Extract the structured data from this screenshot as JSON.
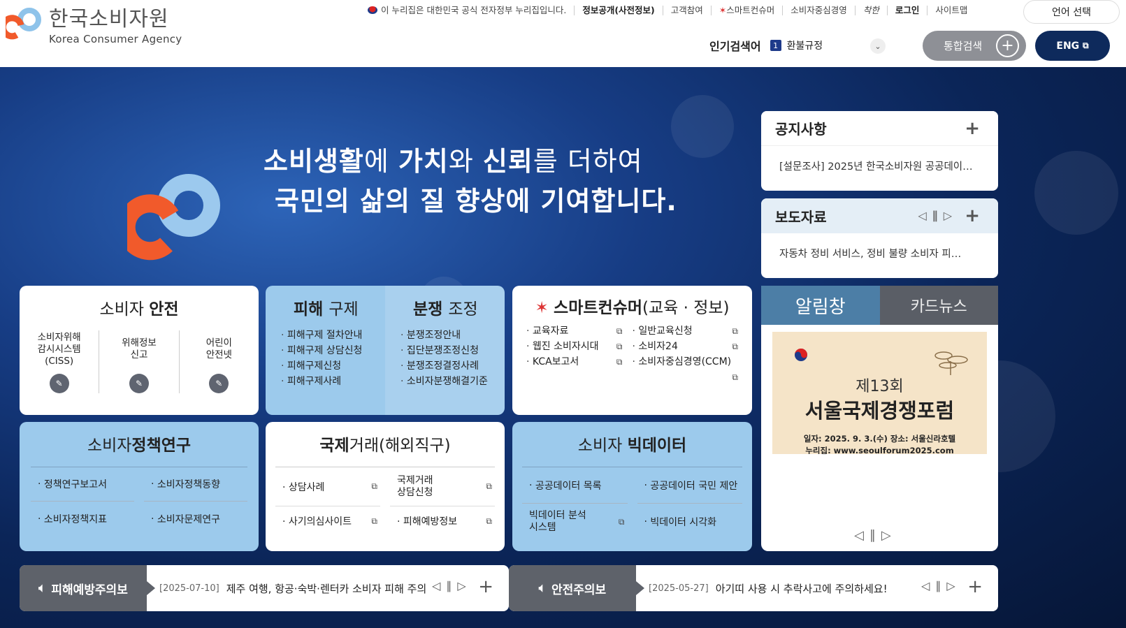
{
  "header": {
    "logo_ko": "한국소비자원",
    "logo_en": "Korea Consumer Agency",
    "gov_notice": "이 누리집은 대한민국 공식 전자정부 누리집입니다.",
    "util_links": [
      "정보공개(사전정보)",
      "고객참여",
      "스마트컨슈머",
      "소비자중심경영",
      "착한",
      "로그인",
      "사이트맵"
    ],
    "language_select": "언어 선택",
    "popular_label": "인기검색어",
    "popular_rank": "1",
    "popular_term": "환불규정",
    "search_label": "통합검색",
    "eng_label": "ENG"
  },
  "hero": {
    "line1_a": "소비생활",
    "line1_b": "에 ",
    "line1_c": "가치",
    "line1_d": "와 ",
    "line1_e": "신뢰",
    "line1_f": "를 더하여",
    "line2": "국민의 삶의 질 향상에 기여합니다."
  },
  "safety": {
    "title_a": "소비자 ",
    "title_b": "안전",
    "items": [
      "소비자위해\n감시시스템\n(CISS)",
      "위해정보\n신고",
      "어린이\n안전넷"
    ]
  },
  "relief": {
    "title_a": "피해 ",
    "title_b": "구제",
    "items": [
      "피해구제 절차안내",
      "피해구제 상담신청",
      "피해구제신청",
      "피해구제사례"
    ]
  },
  "dispute": {
    "title_a": "분쟁 ",
    "title_b": "조정",
    "items": [
      "분쟁조정안내",
      "집단분쟁조정신청",
      "분쟁조정결정사례",
      "소비자분쟁해결기준"
    ]
  },
  "smart": {
    "title_a": "스마트컨슈머",
    "title_b": "(교육 · 정보)",
    "left": [
      "교육자료",
      "웹진 소비자시대",
      "KCA보고서"
    ],
    "right": [
      "일반교육신청",
      "소비자24",
      "소비자중심경영(CCM)"
    ]
  },
  "policy": {
    "title_a": "소비자",
    "title_b": "정책연구",
    "items": [
      "정책연구보고서",
      "소비자정책동향",
      "소비자정책지표",
      "소비자문제연구"
    ]
  },
  "intl": {
    "title_a": "국제",
    "title_b": "거래(해외직구)",
    "items": [
      "상담사례",
      "국제거래\n상담신청",
      "사기의심사이트",
      "피해예방정보"
    ]
  },
  "bigdata": {
    "title_a": "소비자 ",
    "title_b": "빅데이터",
    "items": [
      "공공데이터 목록",
      "공공데이터 국민 제안",
      "빅데이터 분석\n시스템",
      "빅데이터 시각화"
    ]
  },
  "notice": {
    "title": "공지사항",
    "text": "[설문조사] 2025년 한국소비자원 공공데이…"
  },
  "press": {
    "title": "보도자료",
    "text": "자동차 정비 서비스, 정비 불량 소비자 피…"
  },
  "alarm": {
    "tab_on": "알림창",
    "tab_off": "카드뉴스",
    "poster_title": "제13회",
    "poster_sub": "서울국제경쟁포럼",
    "poster_info": "일자: 2025. 9. 3.(수)   장소: 서울신라호텔",
    "poster_url": "누리집: www.seoulforum2025.com"
  },
  "warn1": {
    "label": "피해예방주의보",
    "date": "[2025-07-10]",
    "text": "제주 여행, 항공·숙박·렌터카 소비자 피해 주의"
  },
  "warn2": {
    "label": "안전주의보",
    "date": "[2025-05-27]",
    "text": "아기띠 사용 시 추락사고에 주의하세요!"
  },
  "colors": {
    "brand_orange": "#f15a2b",
    "brand_blue": "#8ec3ea",
    "navy": "#0e2a5c"
  }
}
